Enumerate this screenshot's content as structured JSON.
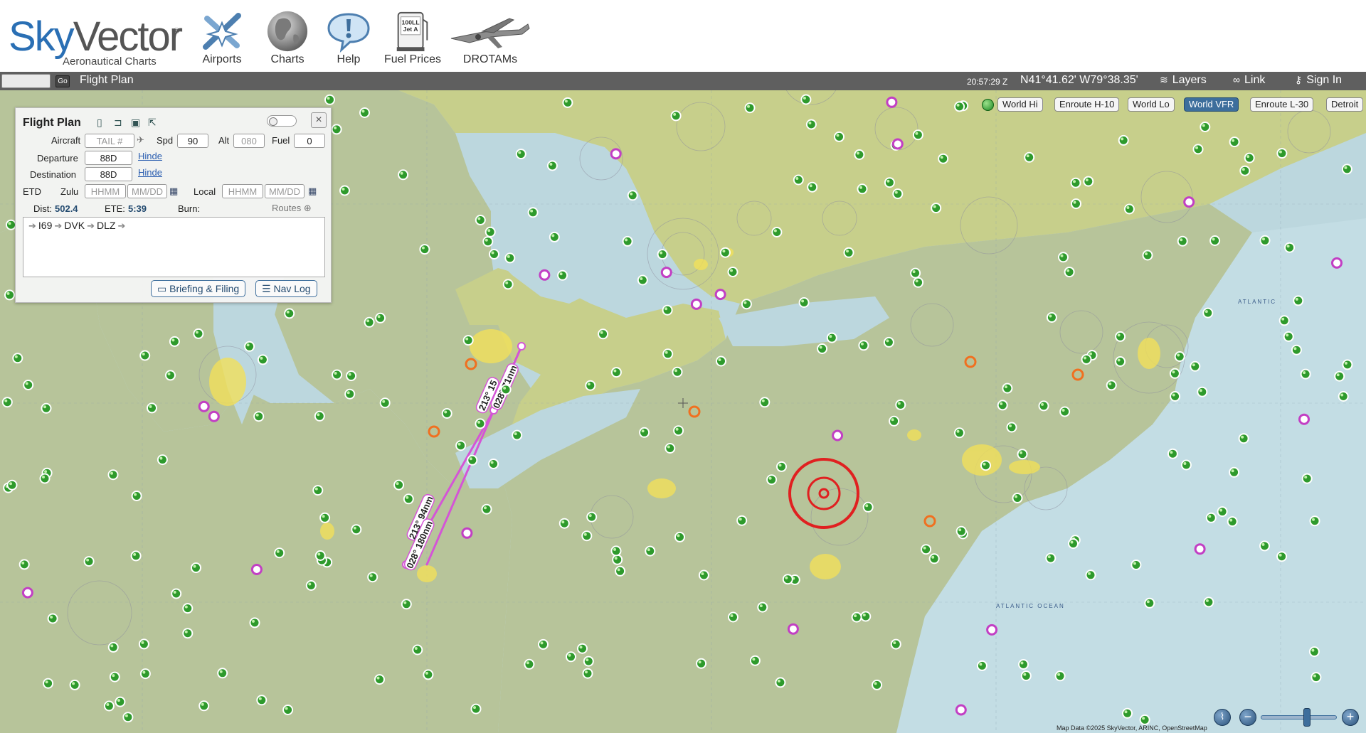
{
  "header": {
    "logo": {
      "brand_sky": "Sky",
      "brand_vector": "Vector",
      "registered": "®",
      "subtitle": "Aeronautical Charts"
    },
    "nav": [
      {
        "label": "Airports",
        "icon": "airport-icon"
      },
      {
        "label": "Charts",
        "icon": "globe-icon"
      },
      {
        "label": "Help",
        "icon": "help-bubble-icon"
      },
      {
        "label": "Fuel Prices",
        "icon": "fuel-pump-icon"
      },
      {
        "label": "DROTAMs",
        "icon": "drone-icon"
      }
    ],
    "fuel_sign_text": "100LL\nJet A"
  },
  "toolbar": {
    "go_label": "Go",
    "flight_plan_label": "Flight Plan",
    "utc_time": "20:57:29 Z",
    "coords": "N41°41.62' W79°38.35'",
    "layers_label": "Layers",
    "link_label": "Link",
    "sign_in_label": "Sign In"
  },
  "chart_buttons": [
    {
      "label": "World Hi",
      "active": false
    },
    {
      "label": "Enroute H-10",
      "active": false
    },
    {
      "label": "World Lo",
      "active": false
    },
    {
      "label": "World VFR",
      "active": true
    },
    {
      "label": "Enroute L-30",
      "active": false
    },
    {
      "label": "Detroit",
      "active": false
    }
  ],
  "flight_plan": {
    "title": "Flight Plan",
    "aircraft_label": "Aircraft",
    "aircraft_placeholder": "TAIL #",
    "speed_label": "Spd",
    "speed_value": "90",
    "alt_label": "Alt",
    "alt_placeholder": "080",
    "fuel_label": "Fuel",
    "fuel_value": "0",
    "departure_label": "Departure",
    "departure_value": "88D",
    "departure_link": "Hinde",
    "destination_label": "Destination",
    "destination_value": "88D",
    "destination_link": "Hinde",
    "etd_label": "ETD",
    "zulu_label": "Zulu",
    "local_label": "Local",
    "time_placeholder": "HHMM",
    "date_placeholder": "MM/DD",
    "dist_label": "Dist:",
    "dist_value": "502.4",
    "ete_label": "ETE:",
    "ete_value": "5:39",
    "burn_label": "Burn:",
    "routes_label": "Routes",
    "route": [
      "I69",
      "DVK",
      "DLZ"
    ],
    "briefing_button": "Briefing & Filing",
    "navlog_button": "Nav Log"
  },
  "map": {
    "leg_labels": [
      "213° 15",
      "028° 71nm",
      "213° 94nm",
      "028° 180nm"
    ],
    "water_labels": [
      "ATLANTIC OCEAN",
      "ATLANTIC"
    ],
    "attribution": "Map Data ©2025 SkyVector, ARINC, OpenStreetMap"
  },
  "colors": {
    "route": "#d455d6",
    "airport_green": "#2e9a2c",
    "restricted_red": "#e02020",
    "active_chart_button": "#3d6e9c"
  }
}
